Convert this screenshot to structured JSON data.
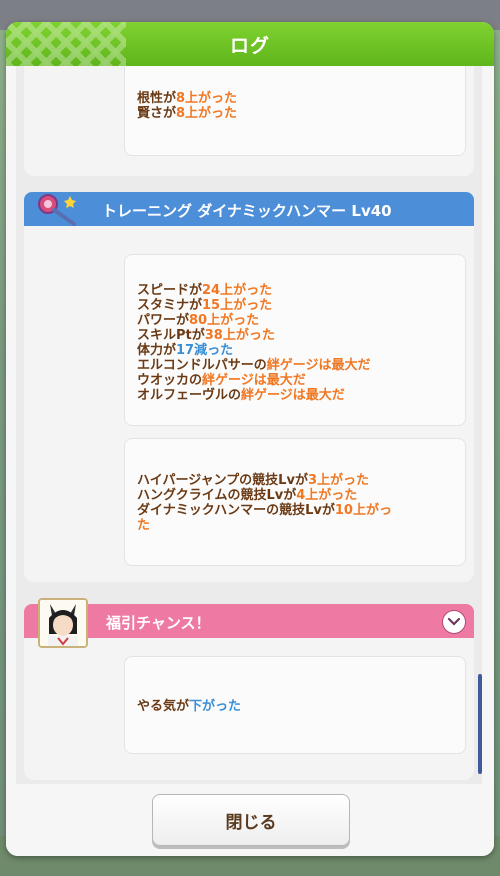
{
  "dialog": {
    "title": "ログ",
    "close_label": "閉じる"
  },
  "colors": {
    "accent_green": "#6cc21f",
    "header_blue": "#4c8fd8",
    "header_pink": "#ee7aa3",
    "text_brown": "#6b3a14",
    "highlight_orange": "#f07823",
    "highlight_blue": "#3a8fd6"
  },
  "top_card": {
    "lines": [
      {
        "pre": "根性が",
        "hl": "8上がった",
        "post": ""
      },
      {
        "pre": "賢さが",
        "hl": "8上がった",
        "post": ""
      }
    ]
  },
  "training_section": {
    "icon": "hammer-icon",
    "title": "トレーニング ダイナミックハンマー Lv40",
    "card1": [
      {
        "pre": "スピードが",
        "hl": "24上がった",
        "post": "",
        "tone": "o"
      },
      {
        "pre": "スタミナが",
        "hl": "15上がった",
        "post": "",
        "tone": "o"
      },
      {
        "pre": "パワーが",
        "hl": "80上がった",
        "post": "",
        "tone": "o"
      },
      {
        "pre": "スキルPtが",
        "hl": "38上がった",
        "post": "",
        "tone": "o"
      },
      {
        "pre": "体力が",
        "hl": "17減った",
        "post": "",
        "tone": "b"
      },
      {
        "pre": "エルコンドルパサーの",
        "hl": "絆ゲージは最大だ",
        "post": "",
        "tone": "o"
      },
      {
        "pre": "ウオッカの",
        "hl": "絆ゲージは最大だ",
        "post": "",
        "tone": "o"
      },
      {
        "pre": "オルフェーヴルの",
        "hl": "絆ゲージは最大だ",
        "post": "",
        "tone": "o"
      }
    ],
    "card2": [
      {
        "pre": "ハイパージャンプの競技Lvが",
        "hl": "3上がった",
        "post": "",
        "tone": "o"
      },
      {
        "pre": "ハングクライムの競技Lvが",
        "hl": "4上がった",
        "post": "",
        "tone": "o"
      },
      {
        "pre": "ダイナミックハンマーの競技Lvが",
        "hl": "10上がっ",
        "post": "",
        "tone": "o"
      },
      {
        "pre": "",
        "hl": "た",
        "post": "",
        "tone": "o"
      }
    ]
  },
  "event_section": {
    "title": "福引チャンス！",
    "avatar": "character-avatar",
    "chevron": "chevron-down-icon",
    "card": [
      {
        "pre": "やる気が",
        "hl": "下がった",
        "post": "",
        "tone": "b"
      }
    ]
  }
}
